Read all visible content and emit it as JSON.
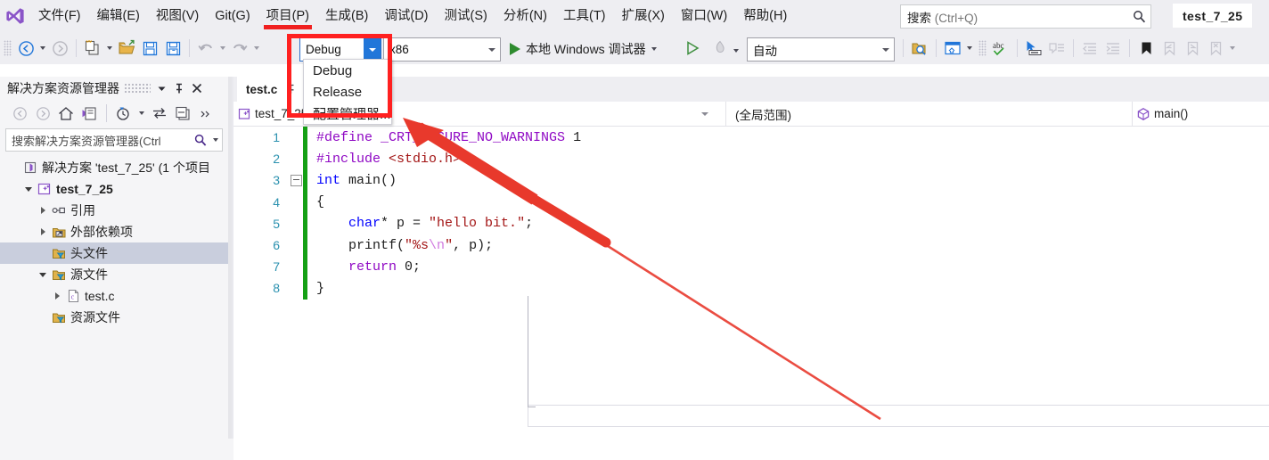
{
  "app": {
    "logo_icon": "visual-studio-logo",
    "solution_badge": "test_7_25"
  },
  "menubar": {
    "items": [
      {
        "label": "文件(F)",
        "highlighted": false
      },
      {
        "label": "编辑(E)",
        "highlighted": false
      },
      {
        "label": "视图(V)",
        "highlighted": false
      },
      {
        "label": "Git(G)",
        "highlighted": false
      },
      {
        "label": "项目(P)",
        "highlighted": true
      },
      {
        "label": "生成(B)",
        "highlighted": false
      },
      {
        "label": "调试(D)",
        "highlighted": false
      },
      {
        "label": "测试(S)",
        "highlighted": false
      },
      {
        "label": "分析(N)",
        "highlighted": false
      },
      {
        "label": "工具(T)",
        "highlighted": false
      },
      {
        "label": "扩展(X)",
        "highlighted": false
      },
      {
        "label": "窗口(W)",
        "highlighted": false
      },
      {
        "label": "帮助(H)",
        "highlighted": false
      }
    ]
  },
  "search": {
    "value": "搜索",
    "hint": " (Ctrl+Q)",
    "icon": "search-icon"
  },
  "toolbar": {
    "nav_back_icon": "navigate-back-icon",
    "nav_forward_icon": "navigate-forward-icon",
    "new_item_icon": "new-item-icon",
    "open_file_icon": "open-file-icon",
    "save_icon": "save-icon",
    "save_all_icon": "save-all-icon",
    "undo_icon": "undo-icon",
    "redo_icon": "redo-icon",
    "configuration": "Debug",
    "platform": "x86",
    "run_label": "本地 Windows 调试器",
    "run_icon": "play-icon",
    "start_no_debug_icon": "play-outline-icon",
    "hot_reload_icon": "hot-reload-icon",
    "process_value": "自动",
    "find_in_files_icon": "find-in-files-icon",
    "window_layout_icon": "window-layout-icon",
    "spell_check_icon": "spell-check-icon",
    "pointer_select_icon": "pointer-select-icon",
    "comment_icon": "comment-selection-icon",
    "uncomment_icon": "uncomment-selection-icon",
    "decrease_indent_icon": "decrease-indent-icon",
    "increase_indent_icon": "increase-indent-icon",
    "toggle_bookmark_icon": "toggle-bookmark-icon",
    "prev_bookmark_icon": "previous-bookmark-icon",
    "next_bookmark_icon": "next-bookmark-icon",
    "clear_bookmark_icon": "clear-bookmarks-icon",
    "overflow_icon": "toolbar-overflow-icon"
  },
  "config_dropdown": {
    "open": true,
    "items": [
      "Debug",
      "Release",
      "配置管理器..."
    ]
  },
  "annotation": {
    "rect_color": "#ff2020",
    "arrow_color": "#e8392c",
    "arrow_from": "990,470",
    "arrow_to": "455,133"
  },
  "solution_explorer": {
    "title": "解决方案资源管理器",
    "dropdown_icon": "chevron-down-icon",
    "pin_icon": "pin-icon",
    "close_icon": "close-icon",
    "tools": [
      {
        "icon": "back-icon"
      },
      {
        "icon": "forward-icon"
      },
      {
        "icon": "home-icon"
      },
      {
        "icon": "solution-explorer-icon"
      },
      {
        "icon": "pending-changes-icon"
      },
      {
        "icon": "sync-with-active-document-icon"
      },
      {
        "icon": "properties-window-icon"
      },
      {
        "icon": "overflow-icon"
      }
    ],
    "search_placeholder": "搜索解决方案资源管理器(Ctrl",
    "search_icon": "search-icon",
    "search_caret_icon": "chevron-down-icon",
    "tree": [
      {
        "label": "解决方案 'test_7_25' (1 个项目",
        "indent": 0,
        "twisty": "none",
        "icon": "solution-icon",
        "bold": false,
        "selected": false
      },
      {
        "label": "test_7_25",
        "indent": 1,
        "twisty": "open",
        "icon": "cpp-project-icon",
        "bold": true,
        "selected": false
      },
      {
        "label": "引用",
        "indent": 2,
        "twisty": "closed",
        "icon": "references-icon",
        "bold": false,
        "selected": false
      },
      {
        "label": "外部依赖项",
        "indent": 2,
        "twisty": "closed",
        "icon": "external-dependencies-icon",
        "bold": false,
        "selected": false
      },
      {
        "label": "头文件",
        "indent": 2,
        "twisty": "none",
        "icon": "filter-folder-icon",
        "bold": false,
        "selected": true
      },
      {
        "label": "源文件",
        "indent": 2,
        "twisty": "open",
        "icon": "filter-folder-icon",
        "bold": false,
        "selected": false
      },
      {
        "label": "test.c",
        "indent": 3,
        "twisty": "closed",
        "icon": "c-file-icon",
        "bold": false,
        "selected": false
      },
      {
        "label": "资源文件",
        "indent": 2,
        "twisty": "none",
        "icon": "filter-folder-icon",
        "bold": false,
        "selected": false
      }
    ]
  },
  "editor": {
    "tab": {
      "name": "test.c",
      "pin_icon": "pin-icon"
    },
    "navbar": {
      "project": "test_7_25",
      "project_icon": "cpp-project-icon",
      "scope": "(全局范围)",
      "member": "main()",
      "member_icon": "method-icon"
    },
    "lines": [
      {
        "num": "1",
        "tokens": [
          {
            "t": "#define ",
            "c": "c-pp"
          },
          {
            "t": "_CRT_SECURE_NO_WARNINGS",
            "c": "c-pp"
          },
          {
            "t": " 1",
            "c": "c-num"
          }
        ],
        "changed": true,
        "fold": false,
        "guide": false,
        "current": false
      },
      {
        "num": "2",
        "tokens": [
          {
            "t": "#include ",
            "c": "c-pp"
          },
          {
            "t": "<stdio.h>",
            "c": "c-hdr"
          }
        ],
        "changed": true,
        "fold": false,
        "guide": false,
        "current": false
      },
      {
        "num": "3",
        "tokens": [
          {
            "t": "int",
            "c": "c-kw"
          },
          {
            "t": " main()",
            "c": "c-plain"
          }
        ],
        "changed": true,
        "fold": true,
        "guide": false,
        "current": false
      },
      {
        "num": "4",
        "tokens": [
          {
            "t": "{",
            "c": "c-plain"
          }
        ],
        "changed": true,
        "fold": false,
        "guide": false,
        "current": false
      },
      {
        "num": "5",
        "tokens": [
          {
            "t": "    ",
            "c": "c-plain"
          },
          {
            "t": "char",
            "c": "c-kw"
          },
          {
            "t": "* p = ",
            "c": "c-plain"
          },
          {
            "t": "\"hello bit.\"",
            "c": "c-str"
          },
          {
            "t": ";",
            "c": "c-plain"
          }
        ],
        "changed": true,
        "fold": false,
        "guide": true,
        "current": false
      },
      {
        "num": "6",
        "tokens": [
          {
            "t": "    printf(",
            "c": "c-plain"
          },
          {
            "t": "\"%s",
            "c": "c-str"
          },
          {
            "t": "\\n",
            "c": "c-esc"
          },
          {
            "t": "\"",
            "c": "c-str"
          },
          {
            "t": ", p);",
            "c": "c-plain"
          }
        ],
        "changed": true,
        "fold": false,
        "guide": true,
        "current": false
      },
      {
        "num": "7",
        "tokens": [
          {
            "t": "    ",
            "c": "c-plain"
          },
          {
            "t": "return",
            "c": "c-pp"
          },
          {
            "t": " 0;",
            "c": "c-plain"
          }
        ],
        "changed": true,
        "fold": false,
        "guide": true,
        "current": false
      },
      {
        "num": "8",
        "tokens": [
          {
            "t": "}",
            "c": "c-plain"
          }
        ],
        "changed": true,
        "fold": false,
        "guide": false,
        "current": true
      }
    ]
  }
}
